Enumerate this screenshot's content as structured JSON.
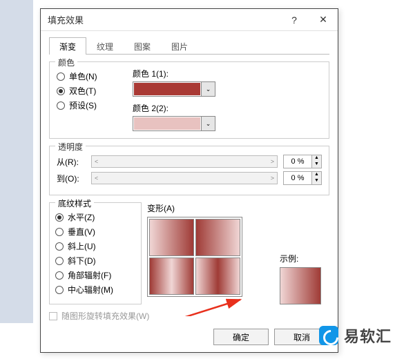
{
  "dialog": {
    "title": "填充效果",
    "help": "?",
    "close": "✕",
    "tabs": [
      "渐变",
      "纹理",
      "图案",
      "图片"
    ],
    "color": {
      "legend": "颜色",
      "options": {
        "single": "单色(N)",
        "double": "双色(T)",
        "preset": "预设(S)"
      },
      "color1_label": "颜色 1(1):",
      "color2_label": "颜色 2(2):",
      "color1": "#a93a35",
      "color2": "#e8c2c0"
    },
    "transparency": {
      "legend": "透明度",
      "from_label": "从(R):",
      "to_label": "到(O):",
      "from_value": "0 %",
      "to_value": "0 %"
    },
    "shapes": {
      "legend": "底纹样式",
      "variants_label": "变形(A)",
      "options": {
        "horizontal": "水平(Z)",
        "vertical": "垂直(V)",
        "diag_up": "斜上(U)",
        "diag_down": "斜下(D)",
        "corner": "角部辐射(F)",
        "center": "中心辐射(M)"
      }
    },
    "sample_label": "示例:",
    "rotate_label": "随图形旋转填充效果(W)",
    "ok": "确定",
    "cancel": "取消"
  },
  "watermark": {
    "text": "易软汇"
  }
}
